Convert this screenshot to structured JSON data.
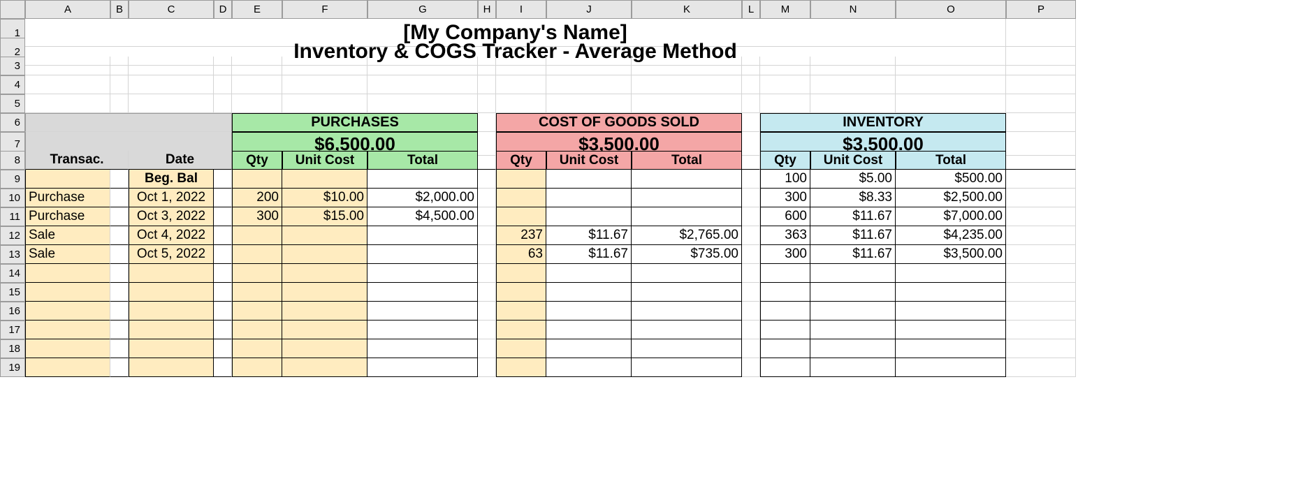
{
  "columns": [
    "A",
    "B",
    "C",
    "D",
    "E",
    "F",
    "G",
    "H",
    "I",
    "J",
    "K",
    "L",
    "M",
    "N",
    "O",
    "P"
  ],
  "title1": "[My Company's Name]",
  "title2": "Inventory & COGS Tracker - Average Method",
  "labels": {
    "transac": "Transac.",
    "date": "Date",
    "purchases": "PURCHASES",
    "cogs": "COST OF GOODS SOLD",
    "inventory": "INVENTORY",
    "qty": "Qty",
    "unitcost": "Unit Cost",
    "total": "Total",
    "begbal": "Beg. Bal"
  },
  "totals": {
    "purchases": "$6,500.00",
    "cogs": "$3,500.00",
    "inventory": "$3,500.00"
  },
  "rows": [
    {
      "transac": "",
      "date": "Beg. Bal",
      "p_qty": "",
      "p_unit": "",
      "p_tot": "",
      "c_qty": "",
      "c_unit": "",
      "c_tot": "",
      "i_qty": "100",
      "i_unit": "$5.00",
      "i_tot": "$500.00"
    },
    {
      "transac": "Purchase",
      "date": "Oct 1, 2022",
      "p_qty": "200",
      "p_unit": "$10.00",
      "p_tot": "$2,000.00",
      "c_qty": "",
      "c_unit": "",
      "c_tot": "",
      "i_qty": "300",
      "i_unit": "$8.33",
      "i_tot": "$2,500.00"
    },
    {
      "transac": "Purchase",
      "date": "Oct 3, 2022",
      "p_qty": "300",
      "p_unit": "$15.00",
      "p_tot": "$4,500.00",
      "c_qty": "",
      "c_unit": "",
      "c_tot": "",
      "i_qty": "600",
      "i_unit": "$11.67",
      "i_tot": "$7,000.00"
    },
    {
      "transac": "Sale",
      "date": "Oct 4, 2022",
      "p_qty": "",
      "p_unit": "",
      "p_tot": "",
      "c_qty": "237",
      "c_unit": "$11.67",
      "c_tot": "$2,765.00",
      "i_qty": "363",
      "i_unit": "$11.67",
      "i_tot": "$4,235.00"
    },
    {
      "transac": "Sale",
      "date": "Oct 5, 2022",
      "p_qty": "",
      "p_unit": "",
      "p_tot": "",
      "c_qty": "63",
      "c_unit": "$11.67",
      "c_tot": "$735.00",
      "i_qty": "300",
      "i_unit": "$11.67",
      "i_tot": "$3,500.00"
    },
    {
      "transac": "",
      "date": "",
      "p_qty": "",
      "p_unit": "",
      "p_tot": "",
      "c_qty": "",
      "c_unit": "",
      "c_tot": "",
      "i_qty": "",
      "i_unit": "",
      "i_tot": ""
    },
    {
      "transac": "",
      "date": "",
      "p_qty": "",
      "p_unit": "",
      "p_tot": "",
      "c_qty": "",
      "c_unit": "",
      "c_tot": "",
      "i_qty": "",
      "i_unit": "",
      "i_tot": ""
    },
    {
      "transac": "",
      "date": "",
      "p_qty": "",
      "p_unit": "",
      "p_tot": "",
      "c_qty": "",
      "c_unit": "",
      "c_tot": "",
      "i_qty": "",
      "i_unit": "",
      "i_tot": ""
    },
    {
      "transac": "",
      "date": "",
      "p_qty": "",
      "p_unit": "",
      "p_tot": "",
      "c_qty": "",
      "c_unit": "",
      "c_tot": "",
      "i_qty": "",
      "i_unit": "",
      "i_tot": ""
    },
    {
      "transac": "",
      "date": "",
      "p_qty": "",
      "p_unit": "",
      "p_tot": "",
      "c_qty": "",
      "c_unit": "",
      "c_tot": "",
      "i_qty": "",
      "i_unit": "",
      "i_tot": ""
    },
    {
      "transac": "",
      "date": "",
      "p_qty": "",
      "p_unit": "",
      "p_tot": "",
      "c_qty": "",
      "c_unit": "",
      "c_tot": "",
      "i_qty": "",
      "i_unit": "",
      "i_tot": ""
    }
  ],
  "chart_data": {
    "type": "table",
    "title": "Inventory & COGS Tracker - Average Method",
    "sections": [
      "PURCHASES",
      "COST OF GOODS SOLD",
      "INVENTORY"
    ],
    "section_totals": {
      "PURCHASES": 6500.0,
      "COST OF GOODS SOLD": 3500.0,
      "INVENTORY": 3500.0
    },
    "columns": [
      "Transac.",
      "Date",
      "Purchases Qty",
      "Purchases Unit Cost",
      "Purchases Total",
      "COGS Qty",
      "COGS Unit Cost",
      "COGS Total",
      "Inventory Qty",
      "Inventory Unit Cost",
      "Inventory Total"
    ],
    "rows": [
      [
        "",
        "Beg. Bal",
        null,
        null,
        null,
        null,
        null,
        null,
        100,
        5.0,
        500.0
      ],
      [
        "Purchase",
        "Oct 1, 2022",
        200,
        10.0,
        2000.0,
        null,
        null,
        null,
        300,
        8.33,
        2500.0
      ],
      [
        "Purchase",
        "Oct 3, 2022",
        300,
        15.0,
        4500.0,
        null,
        null,
        null,
        600,
        11.67,
        7000.0
      ],
      [
        "Sale",
        "Oct 4, 2022",
        null,
        null,
        null,
        237,
        11.67,
        2765.0,
        363,
        11.67,
        4235.0
      ],
      [
        "Sale",
        "Oct 5, 2022",
        null,
        null,
        null,
        63,
        11.67,
        735.0,
        300,
        11.67,
        3500.0
      ]
    ]
  }
}
